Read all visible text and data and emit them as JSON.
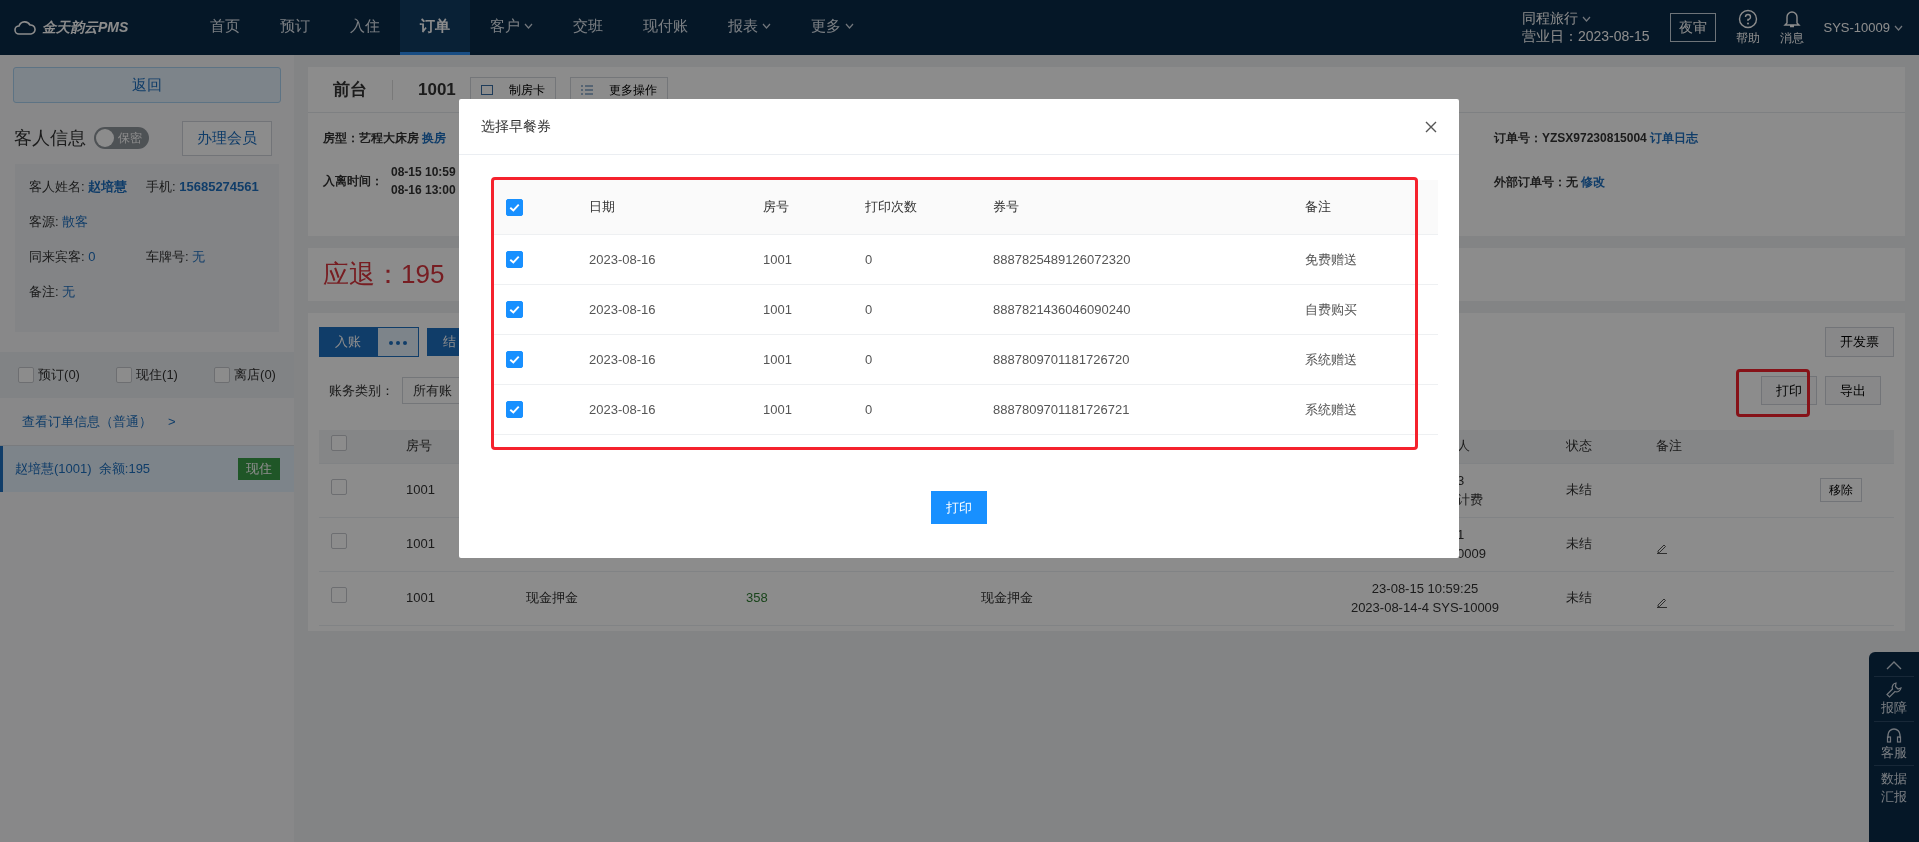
{
  "navbar": {
    "logo": "金天韵云PMS",
    "items": [
      {
        "label": "首页",
        "selected": false,
        "dropdown": false
      },
      {
        "label": "预订",
        "selected": false,
        "dropdown": false
      },
      {
        "label": "入住",
        "selected": false,
        "dropdown": false
      },
      {
        "label": "订单",
        "selected": true,
        "dropdown": false
      },
      {
        "label": "客户",
        "selected": false,
        "dropdown": true
      },
      {
        "label": "交班",
        "selected": false,
        "dropdown": false
      },
      {
        "label": "现付账",
        "selected": false,
        "dropdown": false
      },
      {
        "label": "报表",
        "selected": false,
        "dropdown": true
      },
      {
        "label": "更多",
        "selected": false,
        "dropdown": true
      }
    ],
    "hotel": "同程旅行",
    "business_date": "营业日：2023-08-15",
    "audit_button": "夜审",
    "help": "帮助",
    "messages": "消息",
    "user": "SYS-10009"
  },
  "sidebar": {
    "back_button": "返回",
    "guest_title": "客人信息",
    "privacy_toggle": {
      "label": "保密",
      "on": false
    },
    "member_button": "办理会员",
    "guest_rows": [
      {
        "fields": [
          {
            "label": "客人姓名:",
            "value": "赵培慧",
            "bold": true
          },
          {
            "label": "手机:",
            "value": "15685274561",
            "bold": true
          }
        ]
      },
      {
        "fields": [
          {
            "label": "客源:",
            "value": "散客",
            "bold": false
          }
        ]
      },
      {
        "fields": [
          {
            "label": "同来宾客:",
            "value": "0",
            "bold": false
          },
          {
            "label": "车牌号:",
            "value": "无",
            "bold": false
          }
        ]
      },
      {
        "fields": [
          {
            "label": "备注:",
            "value": "无",
            "bold": false
          }
        ]
      }
    ],
    "filters": [
      {
        "label": "预订(0)",
        "checked": false
      },
      {
        "label": "现住(1)",
        "checked": false
      },
      {
        "label": "离店(0)",
        "checked": false
      }
    ],
    "order_info_link": "查看订单信息（普通）",
    "link_arrow": ">",
    "orders": [
      {
        "name": "赵培慧(1001)",
        "balance": "余额:195",
        "status": "现住",
        "selected": true
      }
    ]
  },
  "main": {
    "header": {
      "title": "前台",
      "room": "1001",
      "buttons": [
        "制房卡",
        "更多操作"
      ]
    },
    "info": {
      "room_type": {
        "label": "房型：",
        "value": "艺程大床房",
        "link": "换房"
      },
      "stay": {
        "label": "入离时间：",
        "check_in": "08-15 10:59",
        "check_out": "08-16 13:00"
      },
      "order_no": {
        "label": "订单号：",
        "value": "YZSX97230815004",
        "link": "订单日志"
      },
      "external_no": {
        "label": "外部订单号：",
        "value": "无",
        "link": "修改"
      }
    },
    "refund": "应退：195",
    "bill": {
      "post_button": "入账",
      "checkout_button": "结",
      "invoice_button": "开发票",
      "category_label": "账务类别：",
      "category_value": "所有账",
      "print_button": "打印",
      "export_button": "导出",
      "header": {
        "checked": false,
        "room": "房号",
        "operator": "人",
        "operator_cut": true,
        "status": "状态",
        "note": "备注"
      },
      "rows": [
        {
          "checked": false,
          "room": "1001",
          "operator": [
            "3",
            "计费"
          ],
          "operator_cut": true,
          "status": "未结",
          "note_icon": false,
          "action": "移除"
        },
        {
          "checked": false,
          "room": "1001",
          "operator": [
            "1",
            "0009"
          ],
          "operator_cut": true,
          "status": "未结",
          "note_icon": true
        },
        {
          "checked": false,
          "room": "1001",
          "item": "现金押金",
          "amount": "358",
          "category": "现金押金",
          "operator": [
            "23-08-15 10:59:25",
            "2023-08-14-4 SYS-10009"
          ],
          "operator_cut": false,
          "status": "未结",
          "note_icon": true
        }
      ]
    }
  },
  "modal": {
    "title": "选择早餐券",
    "select_all": true,
    "columns": [
      "日期",
      "房号",
      "打印次数",
      "券号",
      "备注"
    ],
    "rows": [
      {
        "checked": true,
        "date": "2023-08-16",
        "room": "1001",
        "print_count": "0",
        "voucher_no": "8887825489126072320",
        "note": "免费赠送"
      },
      {
        "checked": true,
        "date": "2023-08-16",
        "room": "1001",
        "print_count": "0",
        "voucher_no": "8887821436046090240",
        "note": "自费购买"
      },
      {
        "checked": true,
        "date": "2023-08-16",
        "room": "1001",
        "print_count": "0",
        "voucher_no": "8887809701181726720",
        "note": "系统赠送"
      },
      {
        "checked": true,
        "date": "2023-08-16",
        "room": "1001",
        "print_count": "0",
        "voucher_no": "8887809701181726721",
        "note": "系统赠送"
      }
    ],
    "print_button": "打印"
  },
  "float_tools": {
    "items": [
      "报障",
      "客服",
      "数据汇报"
    ]
  }
}
